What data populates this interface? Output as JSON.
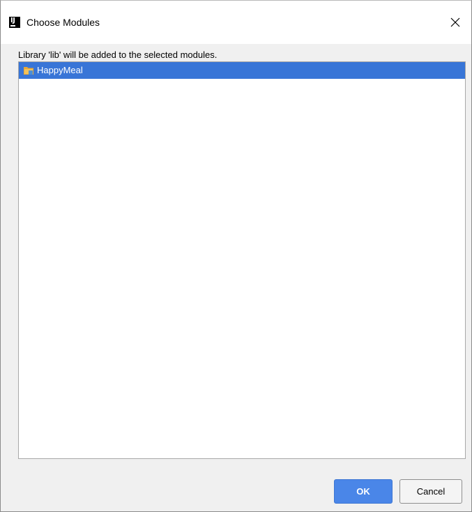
{
  "window": {
    "title": "Choose Modules",
    "icon": "intellij-idea-icon",
    "close_icon": "close-icon"
  },
  "dialog": {
    "description": "Library 'lib' will be added to the selected modules.",
    "modules": [
      {
        "label": "HappyMeal",
        "icon": "module-folder-icon",
        "selected": true
      }
    ]
  },
  "buttons": {
    "ok_label": "OK",
    "cancel_label": "Cancel"
  },
  "colors": {
    "selection": "#3875d7",
    "primary_button": "#4a86e8",
    "folder": "#e8a838",
    "module_badge": "#4a8fd8"
  }
}
